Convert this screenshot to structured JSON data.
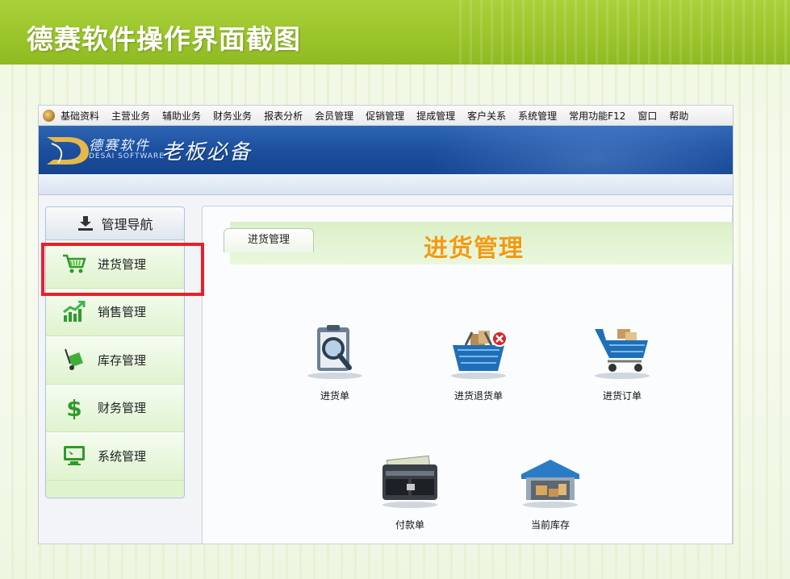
{
  "slide": {
    "title": "德赛软件操作界面截图"
  },
  "menubar": {
    "items": [
      "基础资料",
      "主营业务",
      "辅助业务",
      "财务业务",
      "报表分析",
      "会员管理",
      "促销管理",
      "提成管理",
      "客户关系",
      "系统管理",
      "常用功能F12",
      "窗口",
      "帮助"
    ]
  },
  "banner": {
    "brand_cn": "德赛软件",
    "brand_en": "DESAI SOFTWARE",
    "slogan": "老板必备"
  },
  "nav": {
    "header": "管理导航",
    "items": [
      {
        "label": "进货管理",
        "icon": "cart-icon"
      },
      {
        "label": "销售管理",
        "icon": "chart-up-icon"
      },
      {
        "label": "库存管理",
        "icon": "hand-truck-icon"
      },
      {
        "label": "财务管理",
        "icon": "dollar-icon"
      },
      {
        "label": "系统管理",
        "icon": "monitor-icon"
      }
    ],
    "selected": "进货管理"
  },
  "content": {
    "tab_label": "进货管理",
    "section_title": "进货管理",
    "tiles": [
      {
        "label": "进货单",
        "icon": "clipboard-magnifier-icon"
      },
      {
        "label": "进货退货单",
        "icon": "basket-remove-icon"
      },
      {
        "label": "进货订单",
        "icon": "shopping-cart-icon"
      },
      {
        "label": "付款单",
        "icon": "wallet-icon"
      },
      {
        "label": "当前库存",
        "icon": "warehouse-icon"
      }
    ]
  },
  "colors": {
    "slide_header": "#9cc52c",
    "banner": "#1c4f9e",
    "section_title": "#f29a12",
    "highlight": "#e8202a",
    "nav_green": "#dff3cf"
  }
}
